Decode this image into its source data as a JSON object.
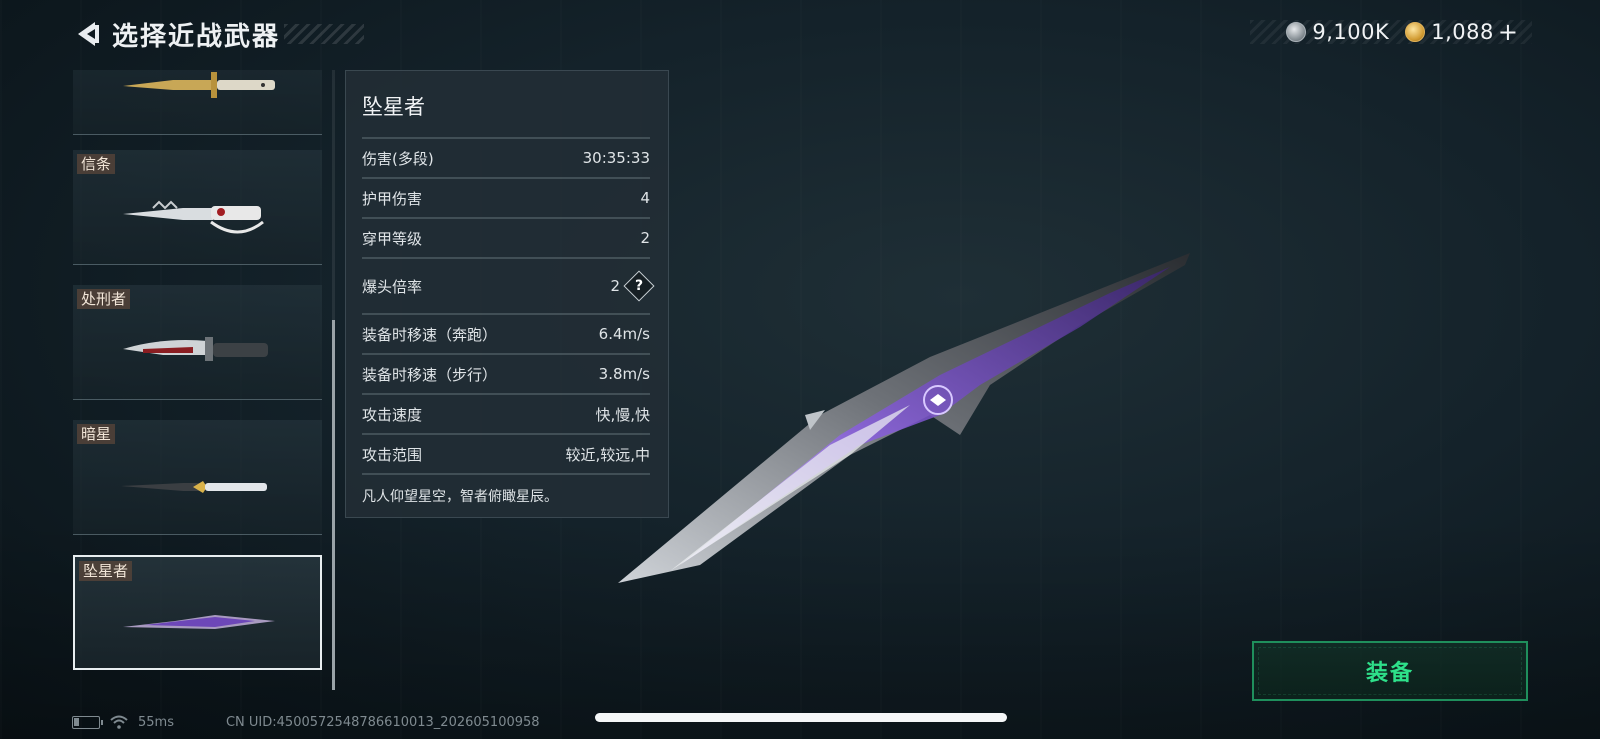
{
  "header": {
    "title": "选择近战武器",
    "back_icon": "back-arrow-icon"
  },
  "currency": {
    "silver": {
      "icon": "silver-coin-icon",
      "value": "9,100K"
    },
    "gold": {
      "icon": "gold-coin-icon",
      "value": "1,088"
    },
    "add_label": "+"
  },
  "weapon_list": {
    "items": [
      {
        "label": "",
        "art": "bayonet-knife",
        "selected": false
      },
      {
        "label": "信条",
        "art": "creed-knife",
        "selected": false
      },
      {
        "label": "处刑者",
        "art": "executioner-knife",
        "selected": false
      },
      {
        "label": "暗星",
        "art": "dark-star-knife",
        "selected": false
      },
      {
        "label": "坠星者",
        "art": "star-faller-knife",
        "selected": true
      }
    ]
  },
  "stats": {
    "name": "坠星者",
    "rows": [
      {
        "label": "伤害(多段)",
        "value": "30:35:33"
      },
      {
        "label": "护甲伤害",
        "value": "4"
      },
      {
        "label": "穿甲等级",
        "value": "2"
      },
      {
        "label": "爆头倍率",
        "value": "2",
        "help": "?"
      },
      {
        "label": "装备时移速（奔跑）",
        "value": "6.4m/s"
      },
      {
        "label": "装备时移速（步行）",
        "value": "3.8m/s"
      },
      {
        "label": "攻击速度",
        "value": "快,慢,快"
      },
      {
        "label": "攻击范围",
        "value": "较近,较远,中"
      }
    ],
    "description": "凡人仰望星空，智者俯瞰星辰。"
  },
  "equip_button": {
    "label": "装备"
  },
  "status_bar": {
    "ping": "55ms",
    "uid": "CN UID:4500572548786610013_202605100958"
  },
  "colors": {
    "accent_green": "#2ee08a",
    "blade_purple": "#7a4fd0"
  }
}
